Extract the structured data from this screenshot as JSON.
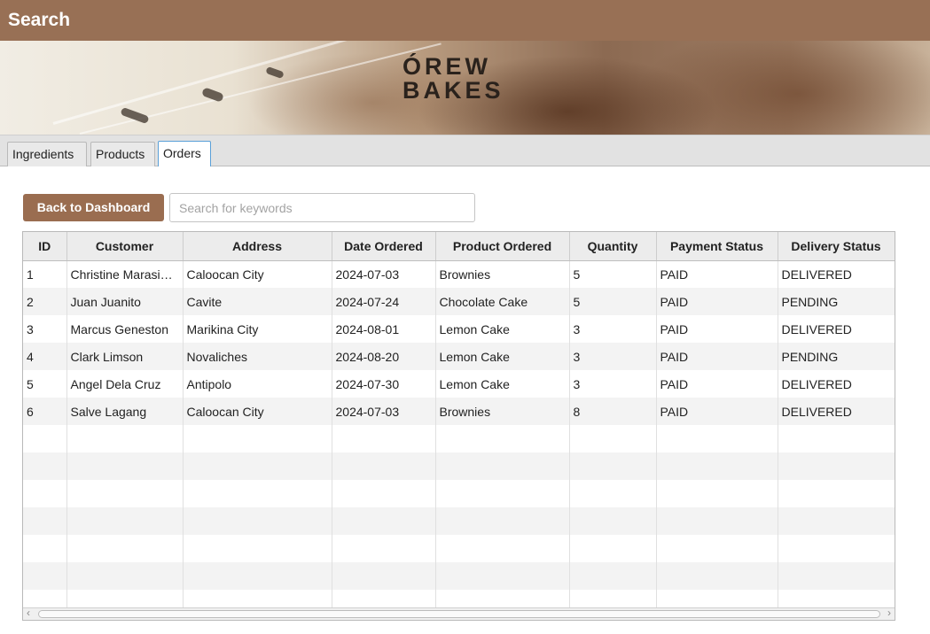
{
  "window": {
    "title": "Search"
  },
  "banner": {
    "logo_line1": "ÓREW",
    "logo_line2": "BAKES"
  },
  "tabs": [
    {
      "label": "Ingredients",
      "active": false
    },
    {
      "label": "Products",
      "active": false
    },
    {
      "label": "Orders",
      "active": true
    }
  ],
  "toolbar": {
    "back_label": "Back to Dashboard",
    "search_placeholder": "Search for keywords",
    "search_value": ""
  },
  "table": {
    "columns": [
      "ID",
      "Customer",
      "Address",
      "Date Ordered",
      "Product Ordered",
      "Quantity",
      "Payment Status",
      "Delivery Status"
    ],
    "rows": [
      [
        "1",
        "Christine Marasigan",
        "Caloocan City",
        "2024-07-03",
        "Brownies",
        "5",
        "PAID",
        "DELIVERED"
      ],
      [
        "2",
        "Juan Juanito",
        "Cavite",
        "2024-07-24",
        "Chocolate Cake",
        "5",
        "PAID",
        "PENDING"
      ],
      [
        "3",
        "Marcus Geneston",
        "Marikina City",
        "2024-08-01",
        "Lemon Cake",
        "3",
        "PAID",
        "DELIVERED"
      ],
      [
        "4",
        "Clark Limson",
        "Novaliches",
        "2024-08-20",
        "Lemon Cake",
        "3",
        "PAID",
        "PENDING"
      ],
      [
        "5",
        "Angel Dela Cruz",
        "Antipolo",
        "2024-07-30",
        "Lemon Cake",
        "3",
        "PAID",
        "DELIVERED"
      ],
      [
        "6",
        "Salve Lagang",
        "Caloocan City",
        "2024-07-03",
        "Brownies",
        "8",
        "PAID",
        "DELIVERED"
      ]
    ],
    "empty_rows": 7
  },
  "colors": {
    "titlebar": "#987055",
    "button": "#9a6d50",
    "active_tab_border": "#5aa0d8"
  }
}
